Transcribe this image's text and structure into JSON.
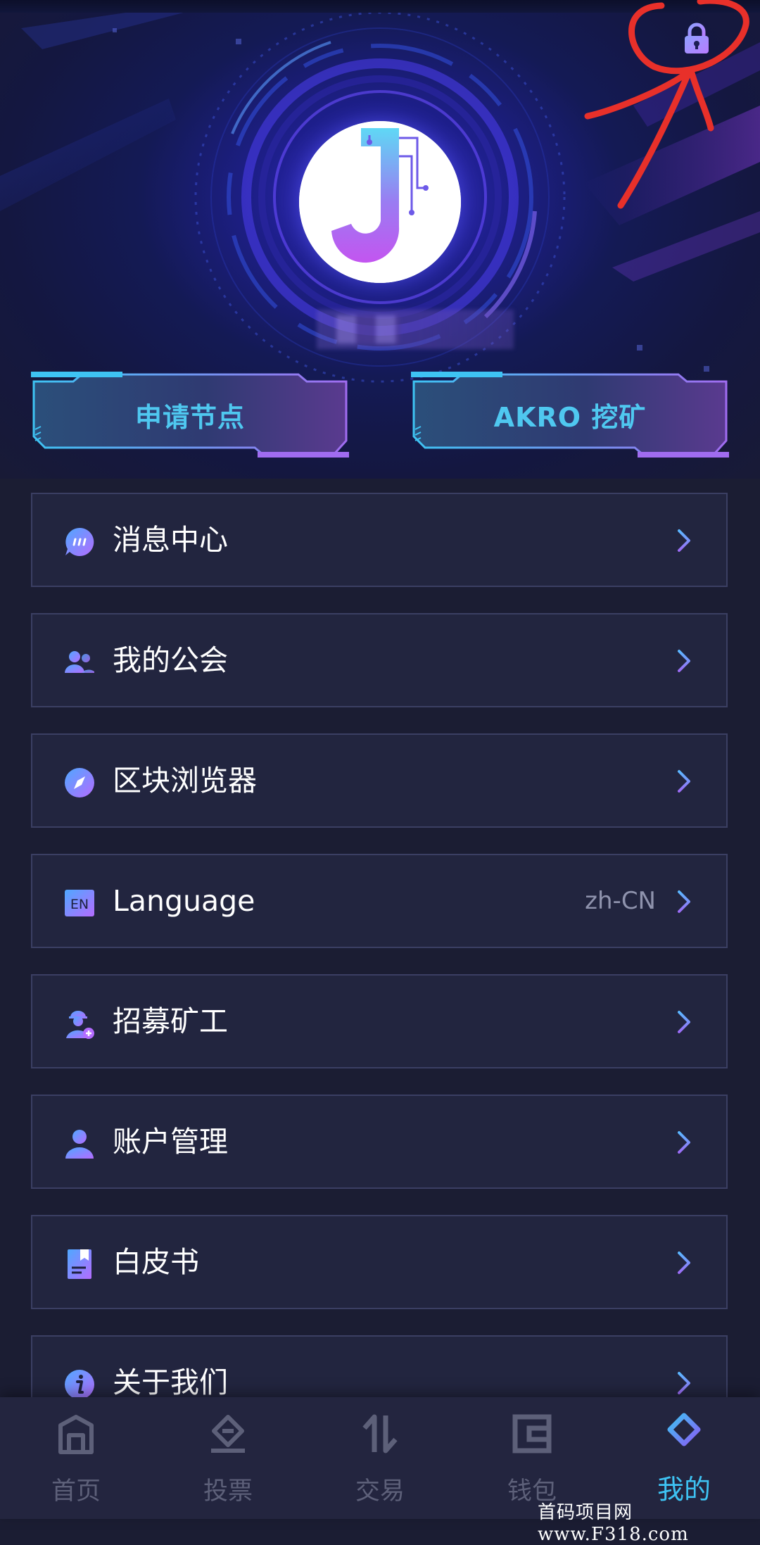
{
  "header": {
    "actions": [
      {
        "label": "申请节点"
      },
      {
        "label": "AKRO 挖矿"
      }
    ]
  },
  "menu": [
    {
      "label": "消息中心",
      "icon": "message-icon"
    },
    {
      "label": "我的公会",
      "icon": "guild-icon"
    },
    {
      "label": "区块浏览器",
      "icon": "compass-icon"
    },
    {
      "label": "Language",
      "icon": "en-icon",
      "value": "zh-CN"
    },
    {
      "label": "招募矿工",
      "icon": "recruit-miner-icon"
    },
    {
      "label": "账户管理",
      "icon": "account-icon"
    },
    {
      "label": "白皮书",
      "icon": "whitepaper-icon"
    },
    {
      "label": "关于我们",
      "icon": "info-icon"
    }
  ],
  "bottom_nav": [
    {
      "label": "首页",
      "icon": "home-icon",
      "active": false
    },
    {
      "label": "投票",
      "icon": "vote-icon",
      "active": false
    },
    {
      "label": "交易",
      "icon": "trade-icon",
      "active": false
    },
    {
      "label": "钱包",
      "icon": "wallet-icon",
      "active": false
    },
    {
      "label": "我的",
      "icon": "mine-icon",
      "active": true
    }
  ],
  "watermark": "首码项目网 www.F318.com",
  "colors": {
    "accent": "#3ec3f3",
    "card_bg": "#22253f",
    "card_border": "#3b3f63",
    "icon_gradient_start": "#4fa8ff",
    "icon_gradient_end": "#b46cff",
    "inactive_nav": "#5d6079"
  }
}
